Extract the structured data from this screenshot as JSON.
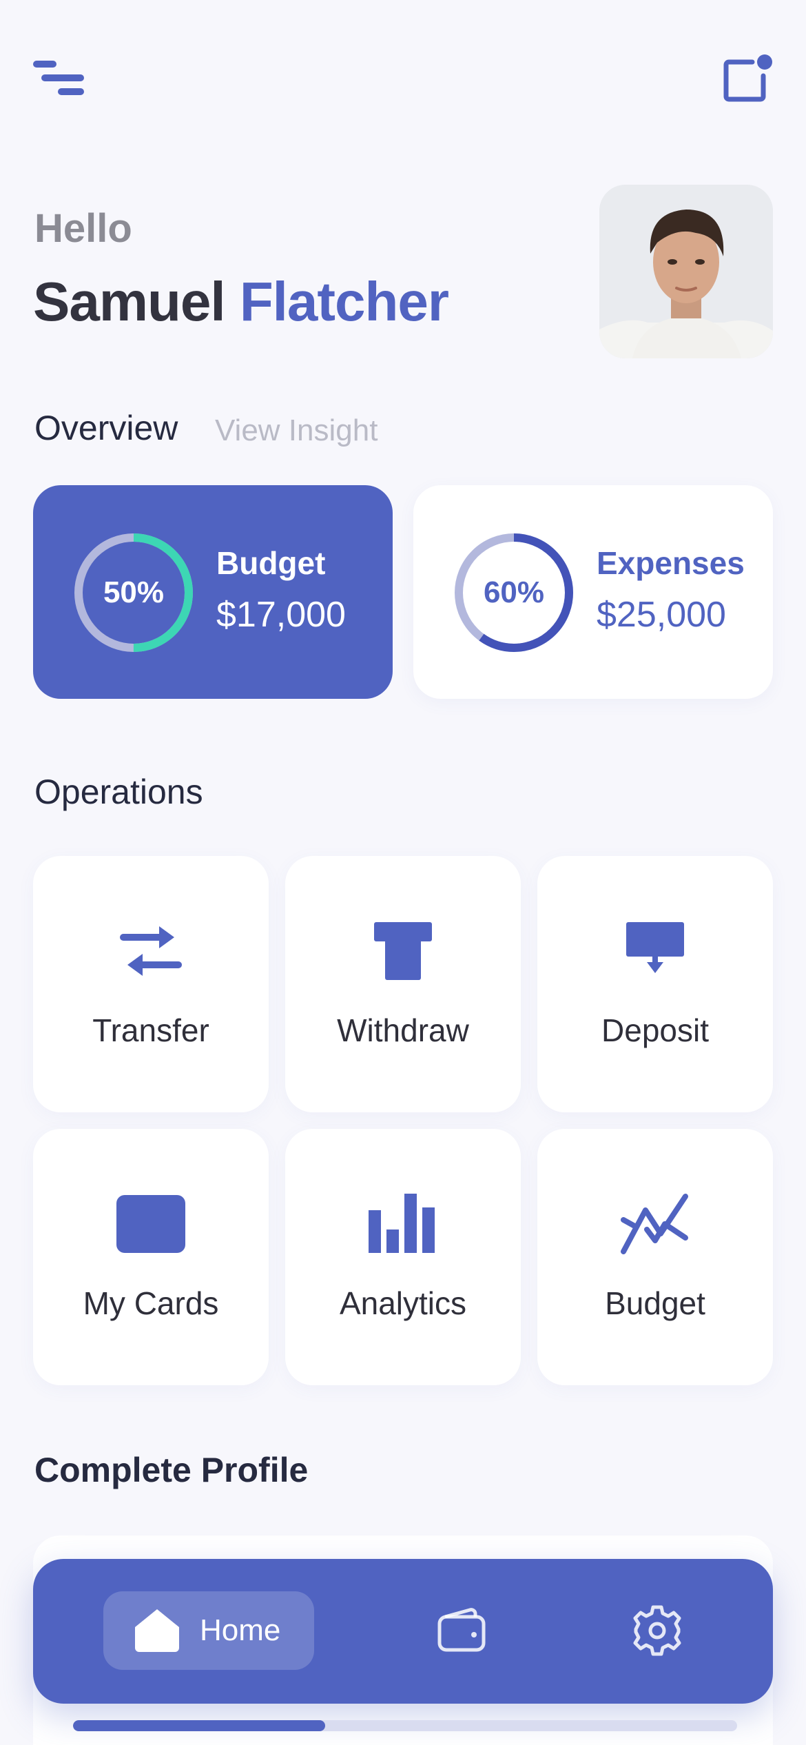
{
  "greeting": {
    "hello": "Hello",
    "first_name": "Samuel",
    "last_name": "Flatcher"
  },
  "overview": {
    "title": "Overview",
    "view_insight": "View Insight",
    "cards": [
      {
        "label": "Budget",
        "amount": "$17,000",
        "percent_text": "50%",
        "percent": 0.5
      },
      {
        "label": "Expenses",
        "amount": "$25,000",
        "percent_text": "60%",
        "percent": 0.6
      }
    ]
  },
  "operations": {
    "title": "Operations",
    "items": [
      {
        "label": "Transfer",
        "icon": "transfer-icon"
      },
      {
        "label": "Withdraw",
        "icon": "withdraw-icon"
      },
      {
        "label": "Deposit",
        "icon": "deposit-icon"
      },
      {
        "label": "My Cards",
        "icon": "card-icon"
      },
      {
        "label": "Analytics",
        "icon": "bar-chart-icon"
      },
      {
        "label": "Budget",
        "icon": "trend-icon"
      }
    ]
  },
  "profile": {
    "title": "Complete Profile",
    "progress": 0.38
  },
  "nav": {
    "home_label": "Home",
    "items": [
      "home-icon",
      "wallet-icon",
      "gear-icon"
    ]
  },
  "colors": {
    "accent": "#5063c1",
    "teal": "#3dd6b4",
    "background": "#f7f7fc",
    "track": "#b3b8dd"
  }
}
